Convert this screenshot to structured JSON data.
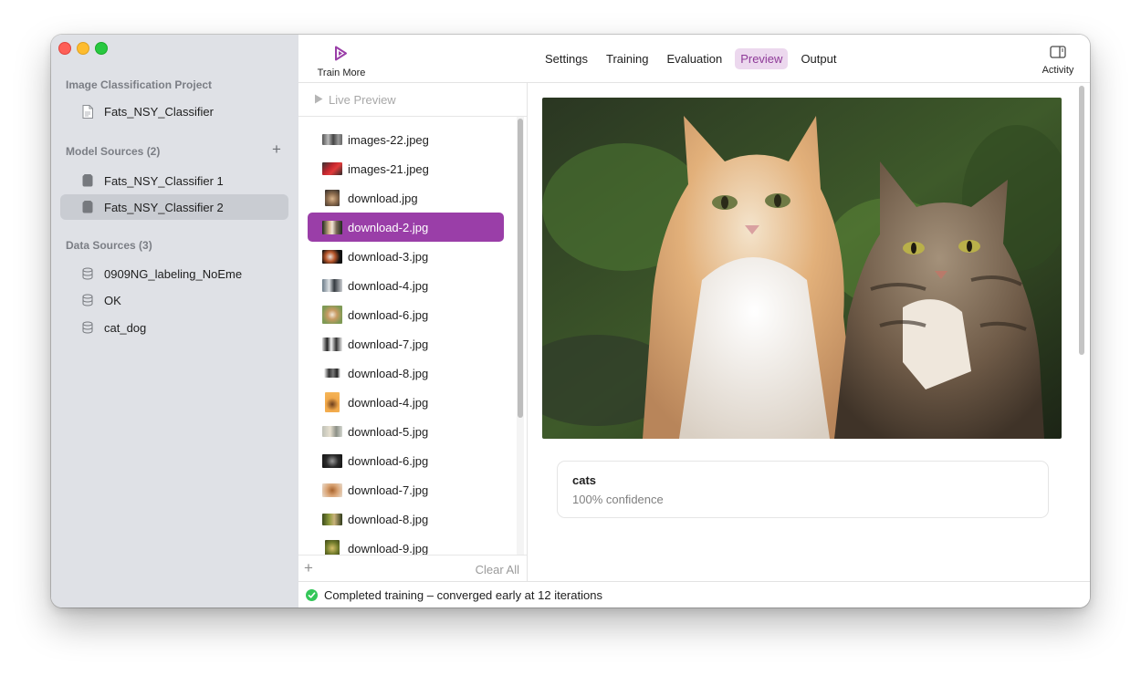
{
  "sidebar": {
    "project_header": "Image Classification Project",
    "project_item": "Fats_NSY_Classifier",
    "model_header": "Model Sources (2)",
    "models": [
      "Fats_NSY_Classifier 1",
      "Fats_NSY_Classifier 2"
    ],
    "selected_model": "Fats_NSY_Classifier 2",
    "data_header": "Data Sources (3)",
    "data_sources": [
      "0909NG_labeling_NoEme",
      "OK",
      "cat_dog"
    ]
  },
  "toolbar": {
    "train_more": "Train More",
    "tabs": [
      "Settings",
      "Training",
      "Evaluation",
      "Preview",
      "Output"
    ],
    "active_tab": "Preview",
    "activity": "Activity",
    "accent_color": "#9a3ea8"
  },
  "list": {
    "live_preview": "Live Preview",
    "files": [
      "images-22.jpeg",
      "images-21.jpeg",
      "download.jpg",
      "download-2.jpg",
      "download-3.jpg",
      "download-4.jpg",
      "download-6.jpg",
      "download-7.jpg",
      "download-8.jpg",
      "download-4.jpg",
      "download-5.jpg",
      "download-6.jpg",
      "download-7.jpg",
      "download-8.jpg",
      "download-9.jpg"
    ],
    "selected_index": 3,
    "clear_all": "Clear All"
  },
  "preview": {
    "label": "cats",
    "confidence": "100% confidence"
  },
  "status": {
    "message": "Completed training – converged early at 12 iterations"
  }
}
